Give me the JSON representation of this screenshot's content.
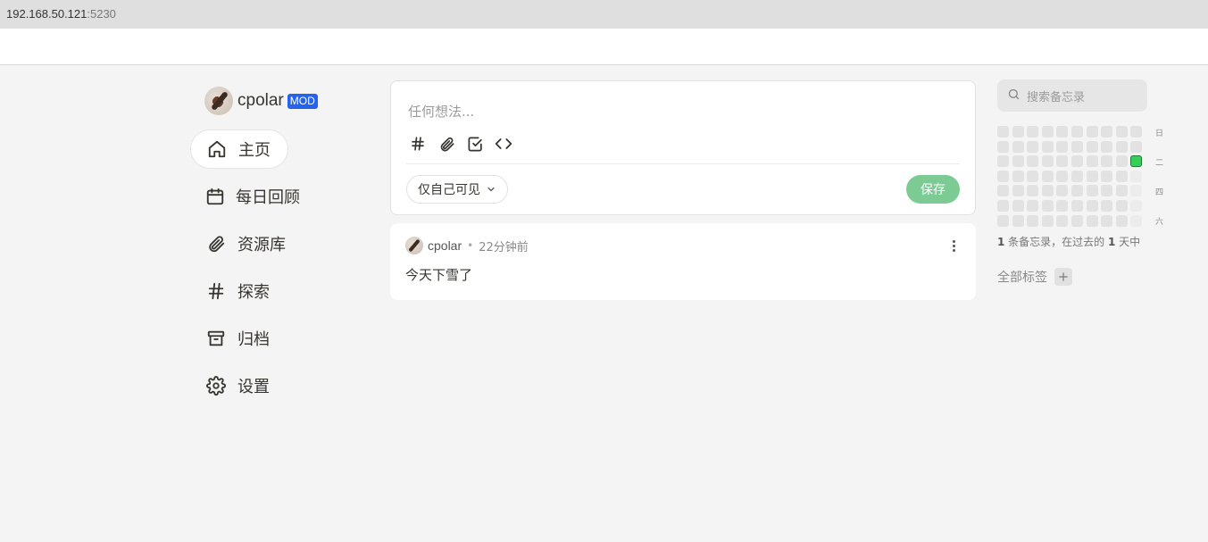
{
  "browser": {
    "host": "192.168.50.121",
    "port": ":5230"
  },
  "profile": {
    "name": "cpolar",
    "badge": "MOD"
  },
  "nav": [
    {
      "label": "主页",
      "icon": "home-icon",
      "active": true
    },
    {
      "label": "每日回顾",
      "icon": "calendar-icon"
    },
    {
      "label": "资源库",
      "icon": "paperclip-icon"
    },
    {
      "label": "探索",
      "icon": "hash-icon"
    },
    {
      "label": "归档",
      "icon": "archive-icon"
    },
    {
      "label": "设置",
      "icon": "gear-icon"
    }
  ],
  "editor": {
    "placeholder": "任何想法...",
    "visibility": "仅自己可见",
    "save_label": "保存",
    "tools": [
      "hash-icon",
      "paperclip-icon",
      "checkbox-icon",
      "code-icon"
    ]
  },
  "memo": {
    "author": "cpolar",
    "separator": "•",
    "time": "22分钟前",
    "content": "今天下雪了"
  },
  "search": {
    "placeholder": "搜索备忘录"
  },
  "heatmap": {
    "day_labels": [
      "日",
      "二",
      "四",
      "六"
    ],
    "active_color": "#34d058"
  },
  "summary": {
    "count": "1",
    "mid": " 条备忘录，在过去的 ",
    "days": "1",
    "end": " 天中"
  },
  "tags": {
    "label": "全部标签"
  },
  "colors": {
    "accent_green": "#7ccb95",
    "badge_blue": "#2563eb"
  }
}
